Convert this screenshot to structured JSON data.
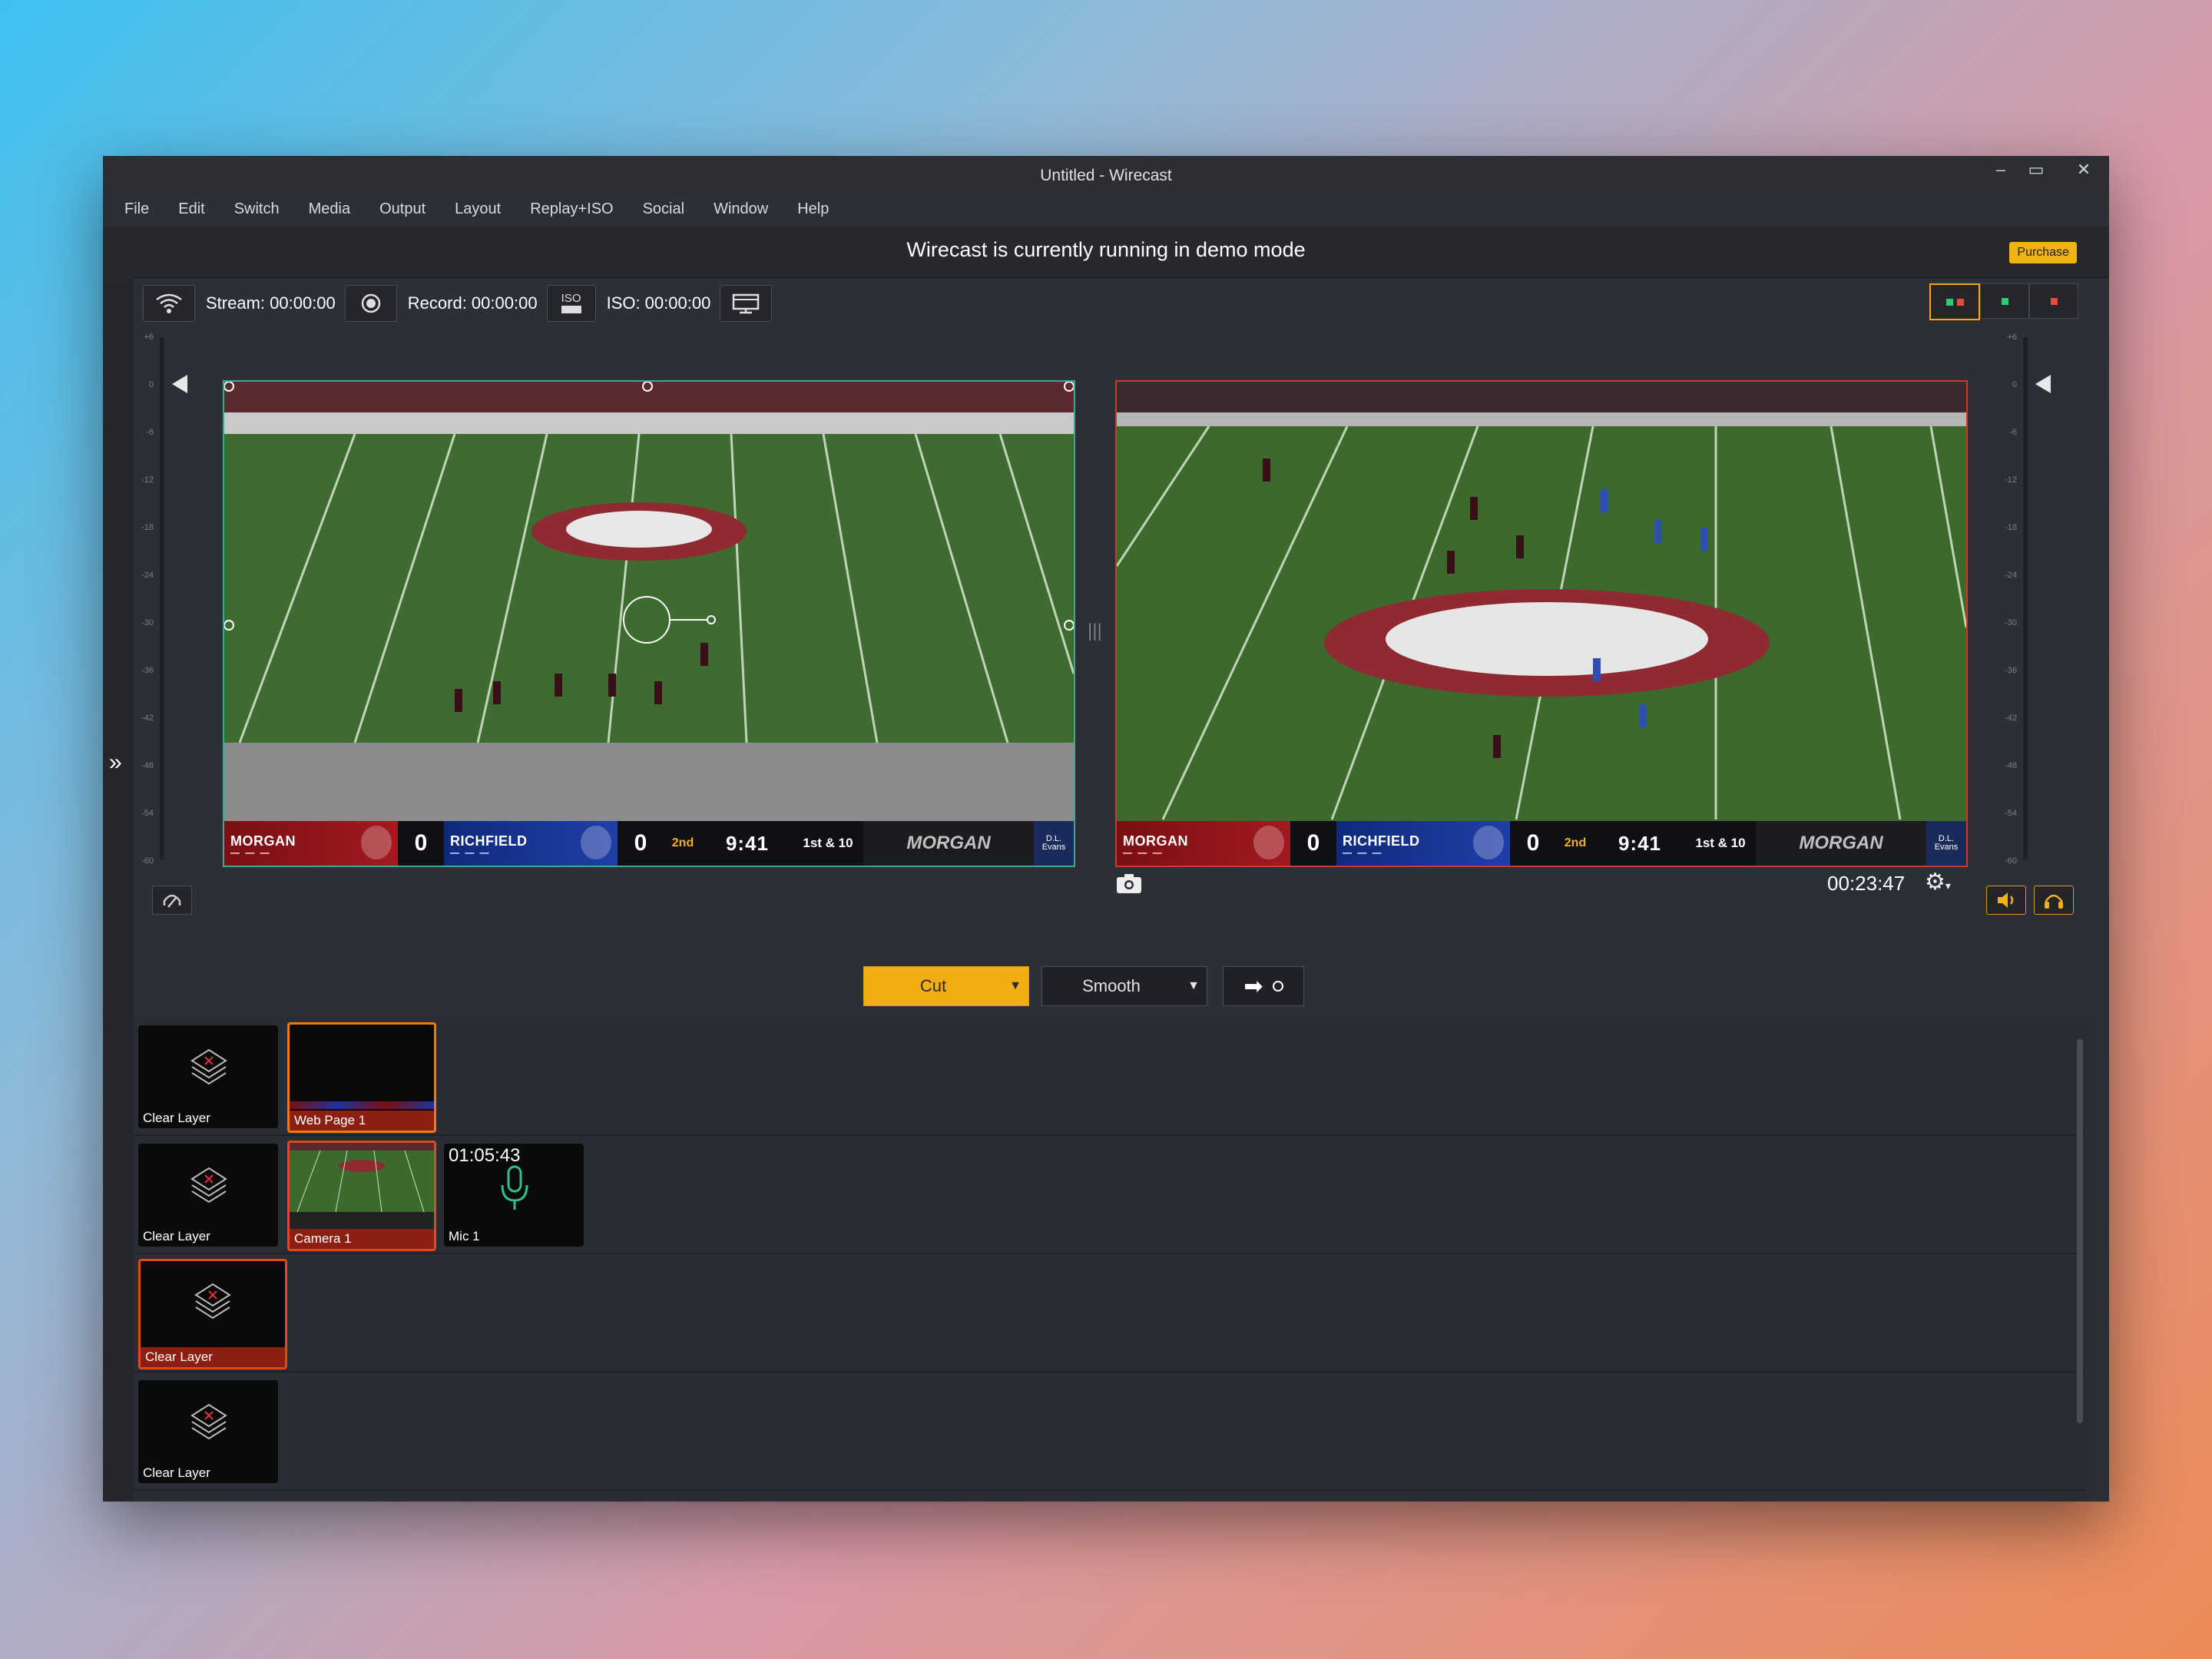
{
  "window": {
    "title": "Untitled - Wirecast"
  },
  "menu": [
    "File",
    "Edit",
    "Switch",
    "Media",
    "Output",
    "Layout",
    "Replay+ISO",
    "Social",
    "Window",
    "Help"
  ],
  "banner": {
    "text": "Wirecast is currently running in demo mode",
    "purchase_label": "Purchase"
  },
  "toolbar": {
    "stream_label": "Stream: 00:00:00",
    "record_label": "Record: 00:00:00",
    "iso_badge": "ISO",
    "iso_label": "ISO: 00:00:00"
  },
  "meter_scale": [
    "+6",
    "0",
    "-6",
    "-12",
    "-18",
    "-24",
    "-30",
    "-36",
    "-42",
    "-48",
    "-54",
    "-60"
  ],
  "scoreboard": {
    "team_a": "MORGAN",
    "score_a": "0",
    "team_b": "RICHFIELD",
    "score_b": "0",
    "quarter": "2nd",
    "clock": "9:41",
    "down": "1st & 10",
    "brand": "MORGAN",
    "sponsor": "D.L. Evans"
  },
  "live": {
    "timecode": "00:23:47"
  },
  "transitions": {
    "cut_label": "Cut",
    "smooth_label": "Smooth"
  },
  "layers": [
    {
      "shots": [
        {
          "label": "Clear Layer"
        },
        {
          "label": "Web Page 1"
        }
      ]
    },
    {
      "shots": [
        {
          "label": "Clear Layer"
        },
        {
          "label": "Camera 1"
        },
        {
          "label": "Mic 1",
          "time": "01:05:43"
        }
      ]
    },
    {
      "shots": [
        {
          "label": "Clear Layer"
        }
      ]
    },
    {
      "shots": [
        {
          "label": "Clear Layer"
        }
      ]
    }
  ],
  "colors": {
    "accent": "#f2ad12",
    "preview_border": "#2fae98",
    "live_border": "#c8392f"
  }
}
